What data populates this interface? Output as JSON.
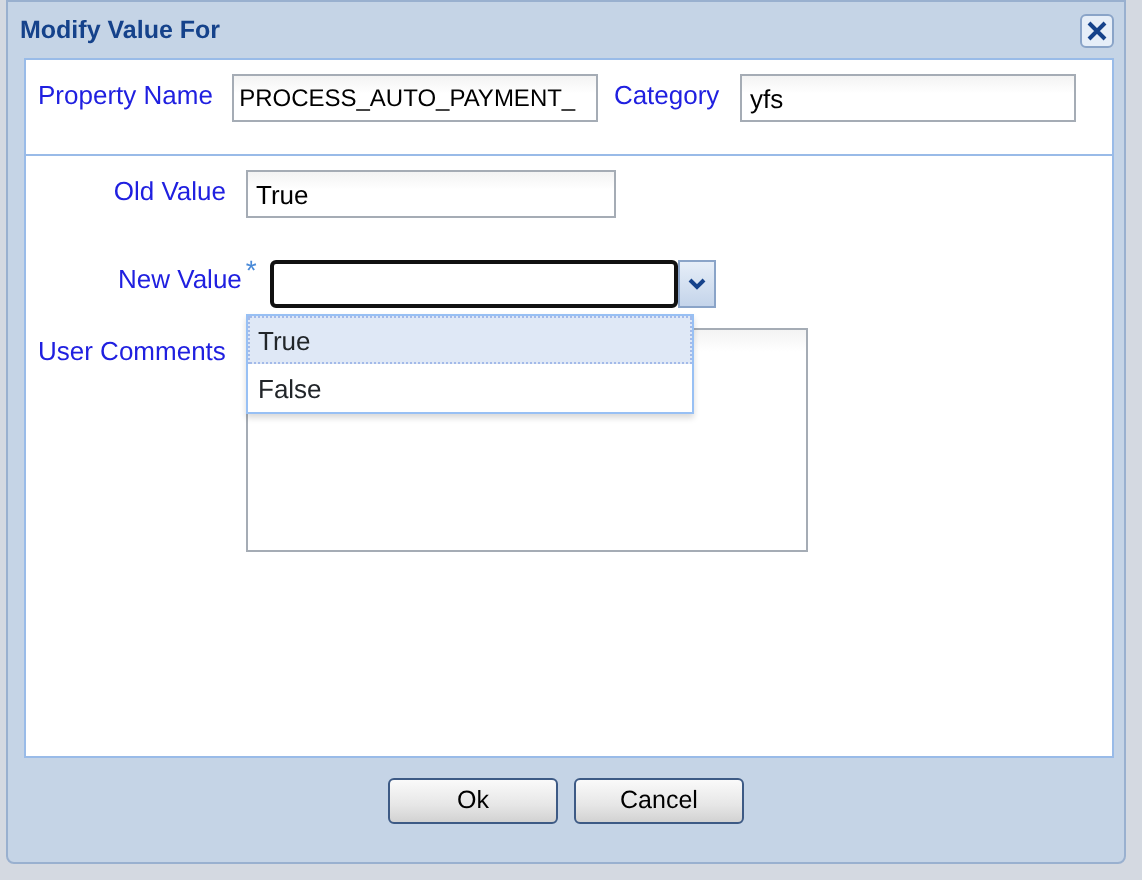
{
  "window": {
    "title": "Modify Value For"
  },
  "header_fields": [
    {
      "label": "Property Name",
      "value": "PROCESS_AUTO_PAYMENT_"
    },
    {
      "label": "Category",
      "value": "yfs"
    }
  ],
  "old_value": {
    "label": "Old Value",
    "value": "True"
  },
  "new_value": {
    "label": "New Value",
    "required_mark": "*",
    "expanded": true,
    "options": [
      {
        "label": "True",
        "selected": true
      },
      {
        "label": "False",
        "selected": false
      }
    ]
  },
  "user_comments": {
    "label": "User Comments"
  },
  "buttons": [
    "Ok",
    "Cancel"
  ]
}
